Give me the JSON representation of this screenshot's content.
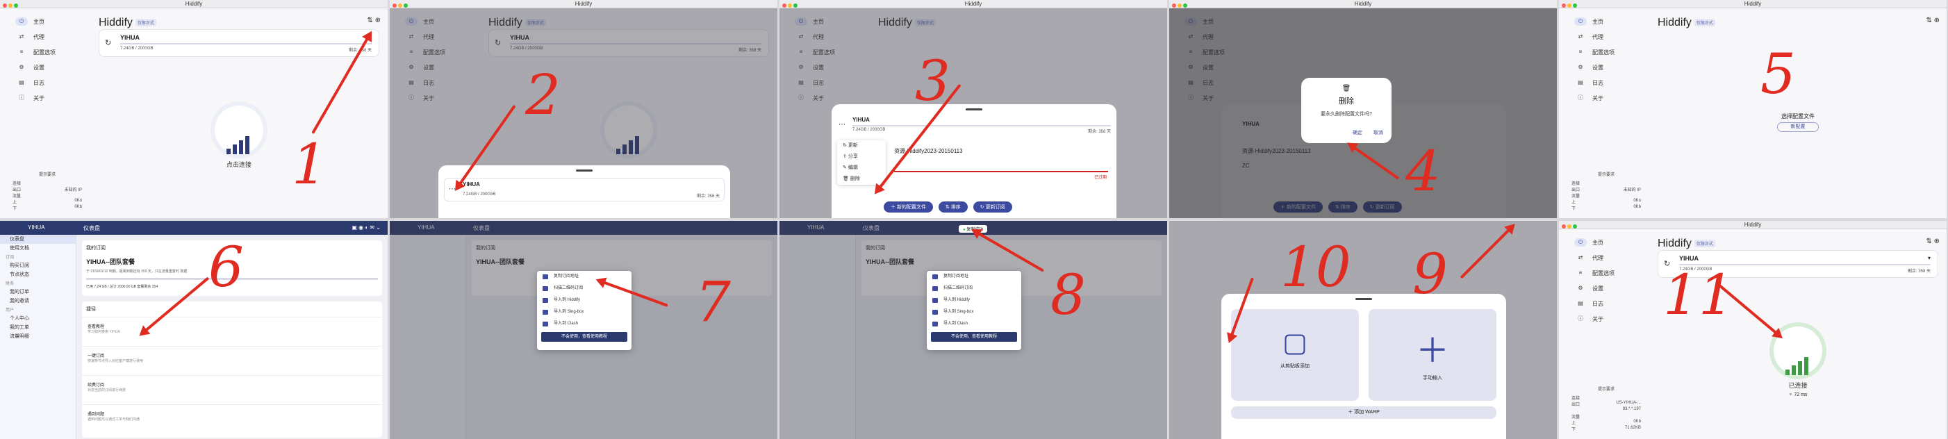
{
  "app": {
    "window_title": "Hiddify",
    "title": "Hiddify",
    "badge": "仅限正式",
    "connect_label": "点击连接",
    "connected_label": "已连接",
    "ping": "72 ms"
  },
  "nav": [
    {
      "label": "主页",
      "icon": "power-icon"
    },
    {
      "label": "代理",
      "icon": "route-icon"
    },
    {
      "label": "配置选项",
      "icon": "sliders-icon"
    },
    {
      "label": "设置",
      "icon": "gear-icon"
    },
    {
      "label": "日志",
      "icon": "log-icon"
    },
    {
      "label": "关于",
      "icon": "info-icon"
    }
  ],
  "sidebar_footer": {
    "section": "提示要求",
    "rows": [
      [
        "连接",
        ""
      ],
      [
        "出口",
        "未知的 IP"
      ],
      [
        "流量",
        ""
      ],
      [
        "上",
        "0Ko"
      ],
      [
        "下",
        "0Kb"
      ]
    ],
    "rows_connected": [
      [
        "连接",
        ""
      ],
      [
        "出口",
        "US-YIHUA-..."
      ],
      [
        "",
        "93.*.*.197"
      ],
      [
        "流量",
        ""
      ],
      [
        "上",
        "0Kb"
      ],
      [
        "下",
        "71.62KB"
      ]
    ]
  },
  "profile": {
    "name": "YIHUA",
    "usage": "7.24GB / 2000GB",
    "remaining": "剩余: 358 天"
  },
  "sheet": {
    "menu": [
      "更新",
      "分享",
      "编辑",
      "删除"
    ],
    "other_profile": "资源-Hiddify2023-20150113",
    "other_profile2": "ZC",
    "expired": "已过期",
    "buttons": [
      "新的配置文件",
      "排序",
      "更新订阅"
    ]
  },
  "dialog": {
    "title": "删除",
    "message": "要永久删除配置文件吗?",
    "confirm": "确定",
    "cancel": "取消"
  },
  "empty": {
    "message": "选择配置文件",
    "button": "新配置"
  },
  "web": {
    "brand": "YIHUA",
    "tab": "仪表盘",
    "menu_groups": [
      {
        "title": "",
        "items": [
          "仪表盘",
          "使用文档"
        ]
      },
      {
        "title": "订阅",
        "items": [
          "购买订阅",
          "节点状态"
        ]
      },
      {
        "title": "财务",
        "items": [
          "我的订单",
          "我的邀请"
        ]
      },
      {
        "title": "用户",
        "items": [
          "个人中心",
          "我的工单",
          "流量明细"
        ]
      }
    ],
    "card_title": "我的订阅",
    "plan": "YIHUA--团队套餐",
    "plan_desc": "于 2150/01/12 到期，距离到期还有 359 天，只在流量重置时 数据",
    "usage": "已用 7.24 GB / 总计 2000.00 GB 套餐剩余 354",
    "shortcuts_title": "捷径",
    "shortcuts": [
      {
        "title": "查看教程",
        "sub": "学习如何使用 YIHUA"
      },
      {
        "title": "一键订阅",
        "sub": "快速将节点导入对应客户端进行使用"
      },
      {
        "title": "续费订阅",
        "sub": "对您当前的订阅进行续费"
      },
      {
        "title": "遇到问题",
        "sub": "遇到问题可以通过工单与我们沟通"
      }
    ],
    "popup": [
      "复制订阅地址",
      "扫描二维码订阅",
      "导入到 Hiddify",
      "导入到 Sing-box",
      "导入到 Clash"
    ],
    "popup_button": "不会使用，查看使用教程",
    "toast": "复制成功"
  },
  "add_sheet": {
    "clipboard": "从剪贴板添加",
    "manual": "手动输入",
    "warp": "添加 WARP"
  },
  "annotations": [
    "1",
    "2",
    "3",
    "4",
    "5",
    "6",
    "7",
    "8",
    "9",
    "10",
    "11"
  ],
  "colors": {
    "accent": "#3c4aa0",
    "connected": "#3f9a45",
    "annotation": "#e02b20"
  }
}
